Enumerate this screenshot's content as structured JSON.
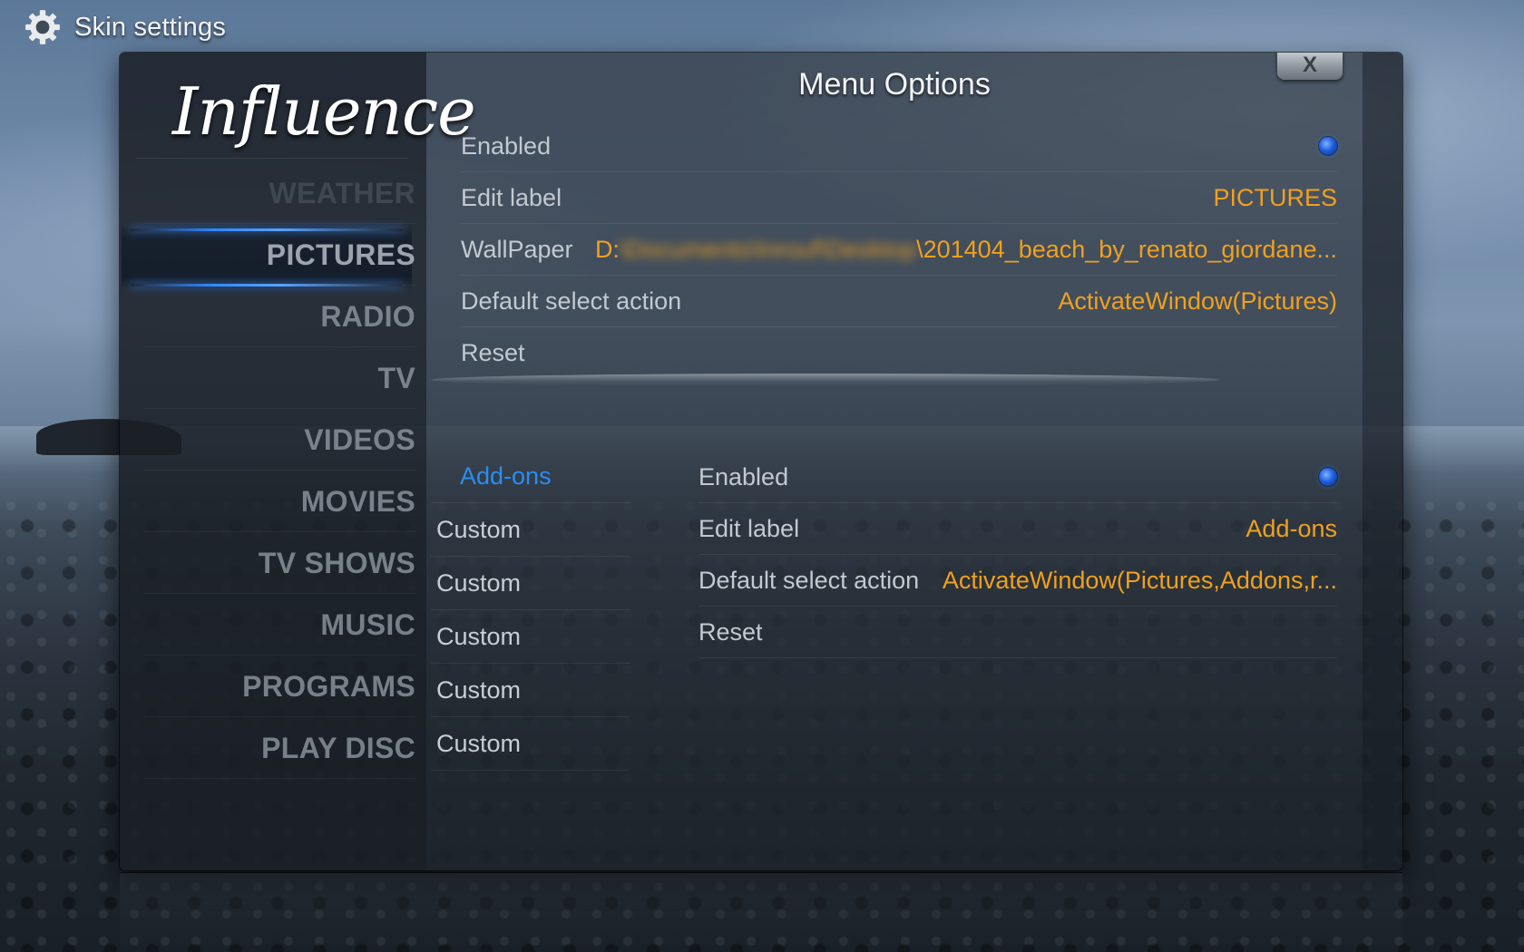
{
  "header": {
    "title": "Skin settings",
    "icon": "gear-icon"
  },
  "logo": {
    "text": "Influence"
  },
  "menu": {
    "items": [
      {
        "label": "WEATHER"
      },
      {
        "label": "PICTURES"
      },
      {
        "label": "RADIO"
      },
      {
        "label": "TV"
      },
      {
        "label": "VIDEOS"
      },
      {
        "label": "MOVIES"
      },
      {
        "label": "TV SHOWS"
      },
      {
        "label": "MUSIC"
      },
      {
        "label": "PROGRAMS"
      },
      {
        "label": "PLAY DISC"
      }
    ],
    "selected": "PICTURES"
  },
  "dialog": {
    "title": "Menu Options",
    "close_label": "X"
  },
  "main_options": {
    "enabled": {
      "label": "Enabled",
      "value": true
    },
    "edit_label": {
      "label": "Edit label",
      "value": "PICTURES"
    },
    "wallpaper": {
      "label": "WallPaper",
      "value_prefix": "D:",
      "value_redacted": "\\Documents\\Inrouf\\Desktop",
      "value_suffix": "\\201404_beach_by_renato_giordane..."
    },
    "default_action": {
      "label": "Default select action",
      "value": "ActivateWindow(Pictures)"
    },
    "reset": {
      "label": "Reset"
    }
  },
  "sub_items": {
    "items": [
      {
        "label": "Add-ons"
      },
      {
        "label": "Custom"
      },
      {
        "label": "Custom"
      },
      {
        "label": "Custom"
      },
      {
        "label": "Custom"
      },
      {
        "label": "Custom"
      }
    ],
    "active_index": 0
  },
  "sub_options": {
    "enabled": {
      "label": "Enabled",
      "value": true
    },
    "edit_label": {
      "label": "Edit label",
      "value": "Add-ons"
    },
    "default_action": {
      "label": "Default select action",
      "value": "ActivateWindow(Pictures,Addons,r..."
    },
    "reset": {
      "label": "Reset"
    }
  },
  "colors": {
    "value_text": "#f0a01e",
    "active_item": "#2b8df2",
    "highlight_bar": "#2f86ff"
  }
}
